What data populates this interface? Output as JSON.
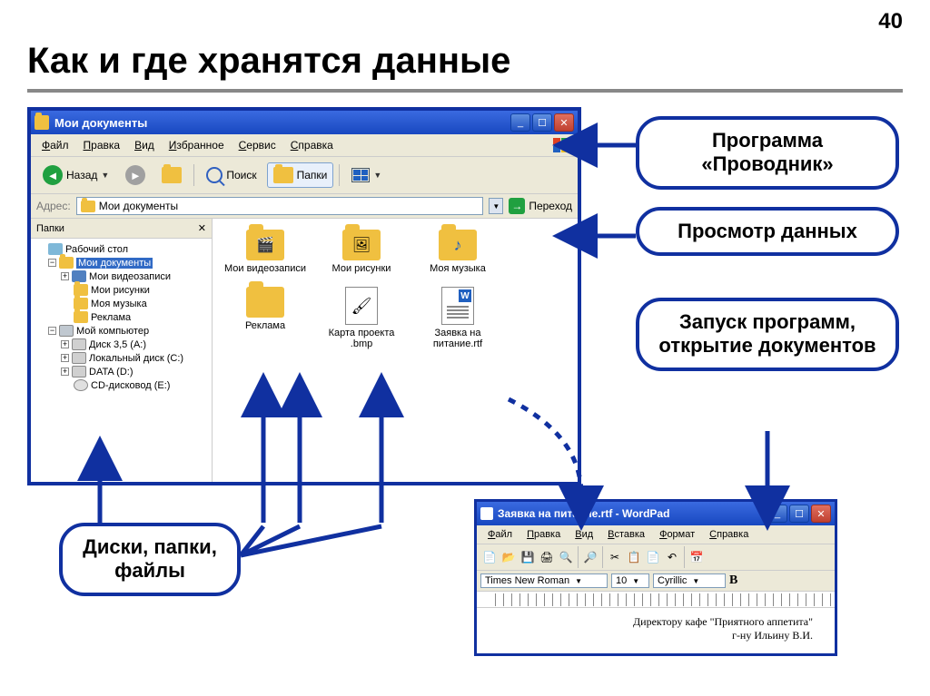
{
  "page_number": "40",
  "slide_title": "Как и где хранятся данные",
  "explorer": {
    "title": "Мои документы",
    "menu": [
      "Файл",
      "Правка",
      "Вид",
      "Избранное",
      "Сервис",
      "Справка"
    ],
    "btn_back": "Назад",
    "btn_search": "Поиск",
    "btn_folders": "Папки",
    "address_label": "Адрес:",
    "address_value": "Мои документы",
    "go_label": "Переход",
    "sidebar_title": "Папки",
    "tree": [
      {
        "indent": 0,
        "pm": "",
        "icon": "desktop",
        "label": "Рабочий стол"
      },
      {
        "indent": 1,
        "pm": "−",
        "icon": "folder",
        "label": "Мои документы",
        "selected": true
      },
      {
        "indent": 2,
        "pm": "+",
        "icon": "video",
        "label": "Мои видеозаписи"
      },
      {
        "indent": 2,
        "pm": "",
        "icon": "folder",
        "label": "Мои рисунки"
      },
      {
        "indent": 2,
        "pm": "",
        "icon": "folder",
        "label": "Моя музыка"
      },
      {
        "indent": 2,
        "pm": "",
        "icon": "folder",
        "label": "Реклама"
      },
      {
        "indent": 1,
        "pm": "−",
        "icon": "computer",
        "label": "Мой компьютер"
      },
      {
        "indent": 2,
        "pm": "+",
        "icon": "disk",
        "label": "Диск 3,5 (A:)"
      },
      {
        "indent": 2,
        "pm": "+",
        "icon": "disk",
        "label": "Локальный диск (C:)"
      },
      {
        "indent": 2,
        "pm": "+",
        "icon": "disk",
        "label": "DATA (D:)"
      },
      {
        "indent": 2,
        "pm": "",
        "icon": "cd",
        "label": "CD-дисковод (E:)"
      }
    ],
    "items": [
      {
        "type": "folder video",
        "label": "Мои видеозаписи"
      },
      {
        "type": "folder pics",
        "label": "Мои рисунки"
      },
      {
        "type": "folder music",
        "label": "Моя музыка"
      },
      {
        "type": "folder",
        "label": "Реклама"
      },
      {
        "type": "bmp",
        "label": "Карта проекта .bmp"
      },
      {
        "type": "rtf",
        "label": "Заявка на питание.rtf"
      }
    ]
  },
  "wordpad": {
    "title": "Заявка на питание.rtf - WordPad",
    "menu": [
      "Файл",
      "Правка",
      "Вид",
      "Вставка",
      "Формат",
      "Справка"
    ],
    "font": "Times New Roman",
    "size": "10",
    "charset": "Cyrillic",
    "line1": "Директору кафе \"Приятного аппетита\"",
    "line2": "г-ну Ильину В.И."
  },
  "callouts": {
    "c1": "Программа «Проводник»",
    "c2": "Просмотр данных",
    "c3": "Запуск программ, открытие документов",
    "c4": "Диски, папки, файлы"
  }
}
